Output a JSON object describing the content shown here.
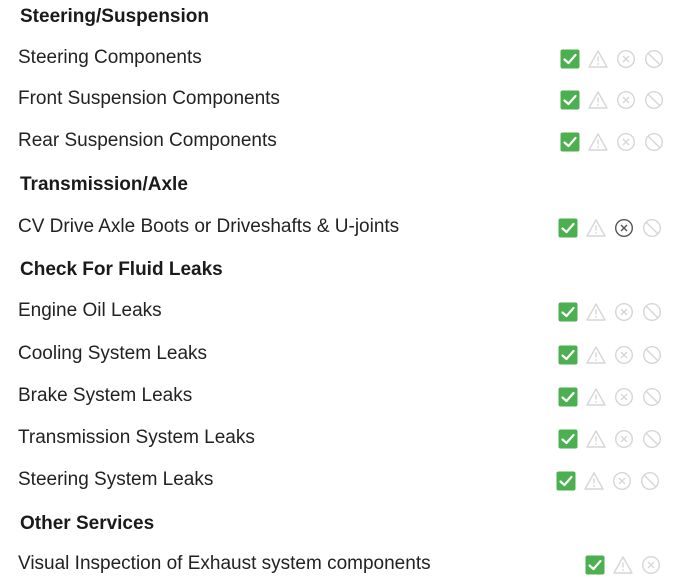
{
  "colors": {
    "check_fill": "#4caf50",
    "icon_muted": "#d6d6d6",
    "icon_dark": "#555555"
  },
  "sections": [
    {
      "title": "Steering/Suspension",
      "items": [
        {
          "label": "Steering Components",
          "status": "pass"
        },
        {
          "label": "Front Suspension Components",
          "status": "pass"
        },
        {
          "label": "Rear Suspension Components",
          "status": "pass"
        }
      ]
    },
    {
      "title": "Transmission/Axle",
      "items": [
        {
          "label": "CV Drive Axle Boots or Driveshafts & U-joints",
          "status": "pass"
        }
      ]
    },
    {
      "title": "Check For Fluid Leaks",
      "items": [
        {
          "label": "Engine Oil Leaks",
          "status": "pass"
        },
        {
          "label": "Cooling System Leaks",
          "status": "pass"
        },
        {
          "label": "Brake System Leaks",
          "status": "pass"
        },
        {
          "label": "Transmission System Leaks",
          "status": "pass"
        },
        {
          "label": "Steering System Leaks",
          "status": "pass"
        }
      ]
    },
    {
      "title": "Other Services",
      "items": [
        {
          "label": "Visual Inspection of Exhaust system components",
          "status": "pass"
        }
      ]
    }
  ],
  "icon_names": [
    "check-icon",
    "warning-icon",
    "fail-icon",
    "not-applicable-icon"
  ]
}
